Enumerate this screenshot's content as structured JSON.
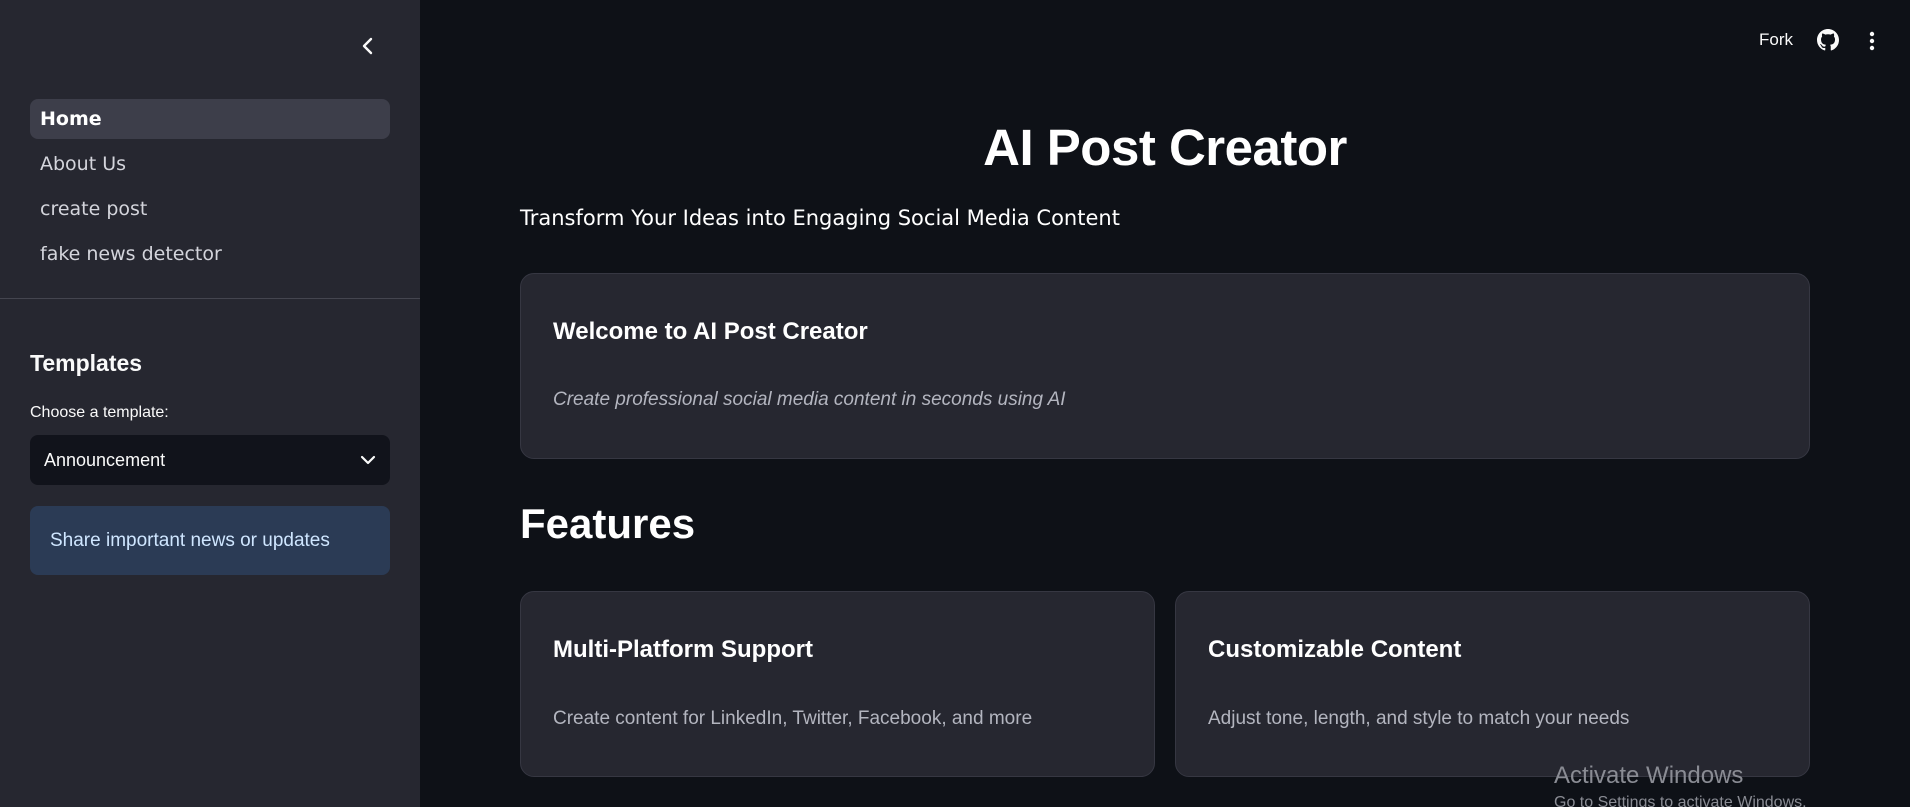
{
  "sidebar": {
    "nav_items": [
      {
        "label": "Home",
        "active": true
      },
      {
        "label": "About Us",
        "active": false
      },
      {
        "label": "create post",
        "active": false
      },
      {
        "label": "fake news detector",
        "active": false
      }
    ],
    "templates_heading": "Templates",
    "select_label": "Choose a template:",
    "select_value": "Announcement",
    "info_text": "Share important news or updates"
  },
  "header": {
    "fork_label": "Fork",
    "github_icon": "github-icon",
    "menu_icon": "more-vertical-icon"
  },
  "main": {
    "title": "AI Post Creator",
    "tagline": "Transform Your Ideas into Engaging Social Media Content",
    "welcome": {
      "title": "Welcome to AI Post Creator",
      "text": "Create professional social media content in seconds using AI"
    },
    "features_heading": "Features",
    "features": [
      {
        "title": "Multi-Platform Support",
        "text": "Create content for LinkedIn, Twitter, Facebook, and more"
      },
      {
        "title": "Customizable Content",
        "text": "Adjust tone, length, and style to match your needs"
      }
    ]
  },
  "watermark": {
    "title": "Activate Windows",
    "subtitle": "Go to Settings to activate Windows."
  },
  "colors": {
    "background": "#0e1117",
    "sidebar": "#262730",
    "card": "#262730",
    "info_box": "#2b3b55",
    "active_nav": "#3d3e4a"
  }
}
